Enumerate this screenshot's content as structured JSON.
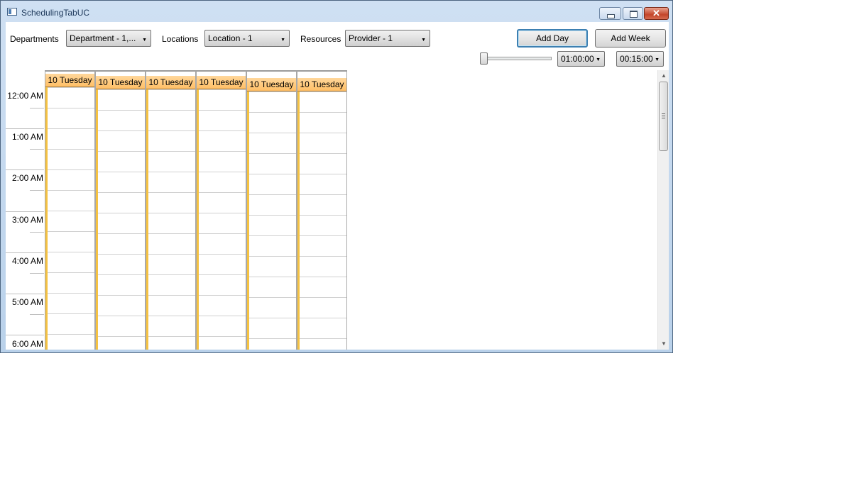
{
  "window": {
    "title": "SchedulingTabUC",
    "close_glyph": "✕"
  },
  "toolbar": {
    "departments_label": "Departments",
    "department_value": "Department - 1,...",
    "locations_label": "Locations",
    "location_value": "Location - 1",
    "resources_label": "Resources",
    "resource_value": "Provider - 1",
    "add_day_label": "Add Day",
    "add_week_label": "Add Week",
    "duration_value": "01:00:00",
    "interval_value": "00:15:00",
    "dropdown_glyph": "▼"
  },
  "scheduler": {
    "time_labels": [
      "12:00 AM",
      "1:00 AM",
      "2:00 AM",
      "3:00 AM",
      "4:00 AM",
      "5:00 AM",
      "6:00 AM"
    ],
    "days": [
      "10 Tuesday",
      "10 Tuesday",
      "10 Tuesday",
      "10 Tuesday",
      "10 Tuesday",
      "10 Tuesday"
    ]
  },
  "scrollbar": {
    "up_glyph": "▲",
    "down_glyph": "▼"
  },
  "colors": {
    "day_header": "#ffc870",
    "accent": "#f5c242",
    "focus": "#3c7fb1"
  }
}
